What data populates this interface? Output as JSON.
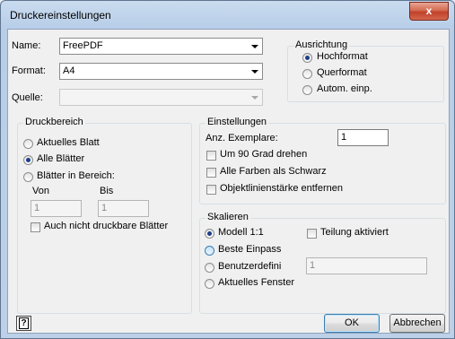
{
  "window": {
    "title": "Druckereinstellungen",
    "close_glyph": "x"
  },
  "printer": {
    "name_label": "Name:",
    "name_value": "FreePDF",
    "format_label": "Format:",
    "format_value": "A4",
    "source_label": "Quelle:",
    "source_value": ""
  },
  "orientation": {
    "title": "Ausrichtung",
    "options": [
      {
        "label": "Hochformat",
        "checked": true
      },
      {
        "label": "Querformat",
        "checked": false
      },
      {
        "label": "Autom. einp.",
        "checked": false
      }
    ]
  },
  "print_range": {
    "title": "Druckbereich",
    "options": [
      {
        "label": "Aktuelles Blatt",
        "checked": false
      },
      {
        "label": "Alle Blätter",
        "checked": true
      },
      {
        "label": "Blätter in Bereich:",
        "checked": false
      }
    ],
    "from_label": "Von",
    "from_value": "1",
    "to_label": "Bis",
    "to_value": "1",
    "non_printable_label": "Auch nicht druckbare Blätter"
  },
  "settings": {
    "title": "Einstellungen",
    "copies_label": "Anz. Exemplare:",
    "copies_value": "1",
    "checks": [
      {
        "label": "Um 90 Grad drehen",
        "checked": false
      },
      {
        "label": "Alle Farben als Schwarz",
        "checked": false
      },
      {
        "label": "Objektlinienstärke entfernen",
        "checked": false
      }
    ]
  },
  "scaling": {
    "title": "Skalieren",
    "options": [
      {
        "label": "Modell 1:1",
        "checked": true
      },
      {
        "label": "Beste Einpass",
        "checked": false
      },
      {
        "label": "Benutzerdefini",
        "checked": false
      },
      {
        "label": "Aktuelles Fenster",
        "checked": false
      }
    ],
    "tiling_label": "Teilung aktiviert",
    "custom_value": "1"
  },
  "footer": {
    "ok_label": "OK",
    "cancel_label": "Abbrechen",
    "help_glyph": "?"
  }
}
